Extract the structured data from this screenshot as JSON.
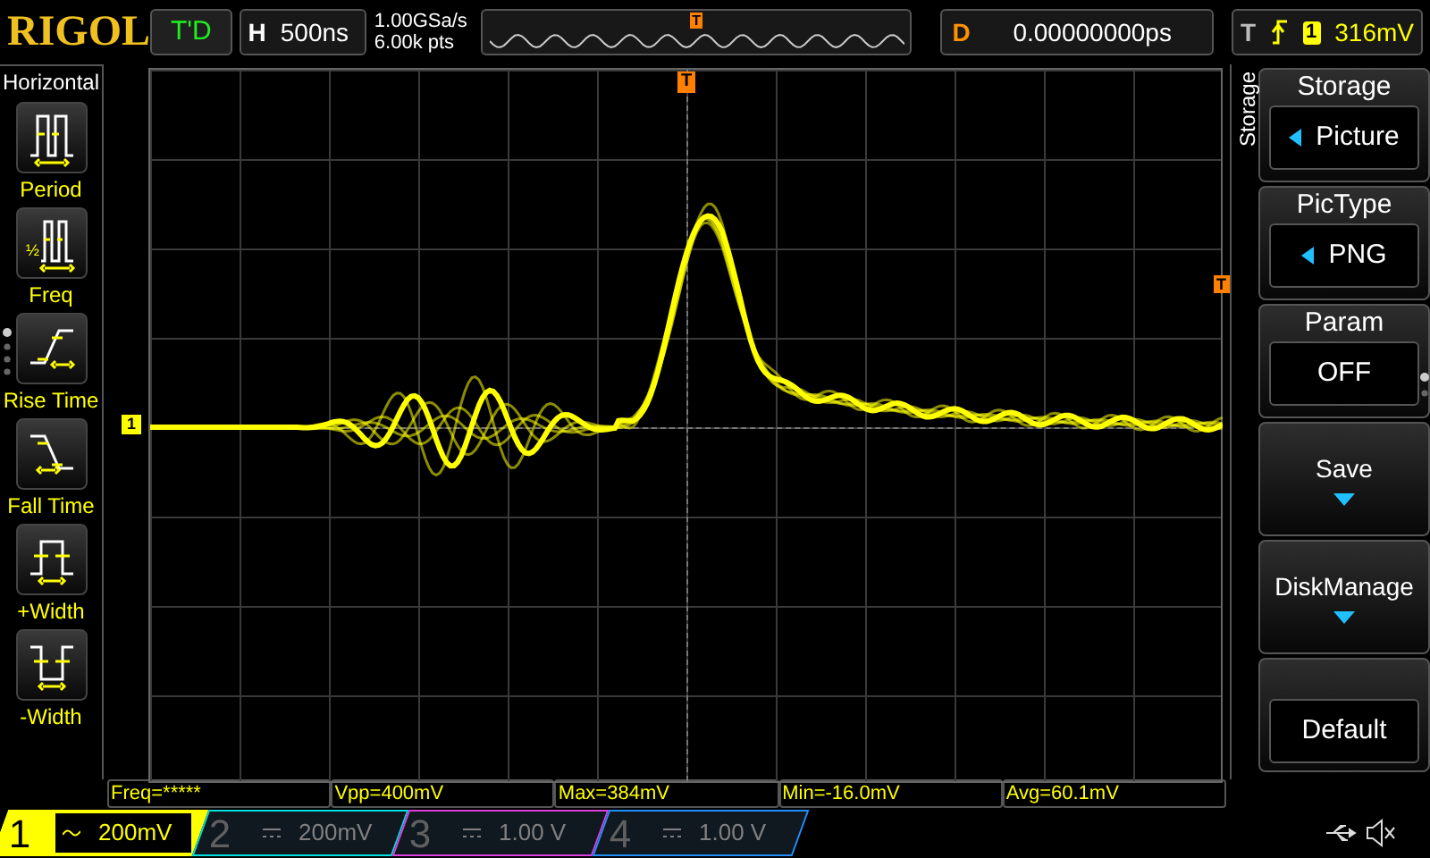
{
  "logo": "RIGOL",
  "run_status": "T'D",
  "horizontal": {
    "label": "H",
    "timebase": "500ns"
  },
  "acquisition": {
    "sample_rate": "1.00GSa/s",
    "memory_depth": "6.00k pts"
  },
  "overview_trigger_marker": "T",
  "delay": {
    "label": "D",
    "value": "0.00000000ps"
  },
  "trigger": {
    "label": "T",
    "source": "1",
    "level": "316mV"
  },
  "trigger_level_marker": "T",
  "channel_marker": "1",
  "trigger_position_marker": "T",
  "left_menu": {
    "title": "Horizontal",
    "items": [
      {
        "kind": "period",
        "label": "Period"
      },
      {
        "kind": "freq",
        "label": "Freq",
        "glyph": "½"
      },
      {
        "kind": "rise",
        "label": "Rise Time"
      },
      {
        "kind": "fall",
        "label": "Fall Time"
      },
      {
        "kind": "pwidth",
        "label": "+Width"
      },
      {
        "kind": "nwidth",
        "label": "-Width"
      }
    ]
  },
  "right_menu": {
    "title": "Storage",
    "items": [
      {
        "kind": "select",
        "label": "Storage",
        "value": "Picture"
      },
      {
        "kind": "select",
        "label": "PicType",
        "value": "PNG"
      },
      {
        "kind": "value",
        "label": "Param",
        "value": "OFF"
      },
      {
        "kind": "submenu",
        "label": "Save"
      },
      {
        "kind": "submenu",
        "label": "DiskManage"
      },
      {
        "kind": "action",
        "value": "Default"
      }
    ]
  },
  "measurements": [
    "Freq=*****",
    "Vpp=400mV",
    "Max=384mV",
    "Min=-16.0mV",
    "Avg=60.1mV"
  ],
  "channels": [
    {
      "number": "1",
      "ac_coupled": true,
      "scale": "200mV",
      "selected": true,
      "color": "#ffff00"
    },
    {
      "number": "2",
      "ac_coupled": false,
      "scale": "200mV",
      "selected": false,
      "color": "#00e0e0"
    },
    {
      "number": "3",
      "ac_coupled": false,
      "scale": "1.00 V",
      "selected": false,
      "color": "#e040e0"
    },
    {
      "number": "4",
      "ac_coupled": false,
      "scale": "1.00 V",
      "selected": false,
      "color": "#2090ff"
    }
  ]
}
